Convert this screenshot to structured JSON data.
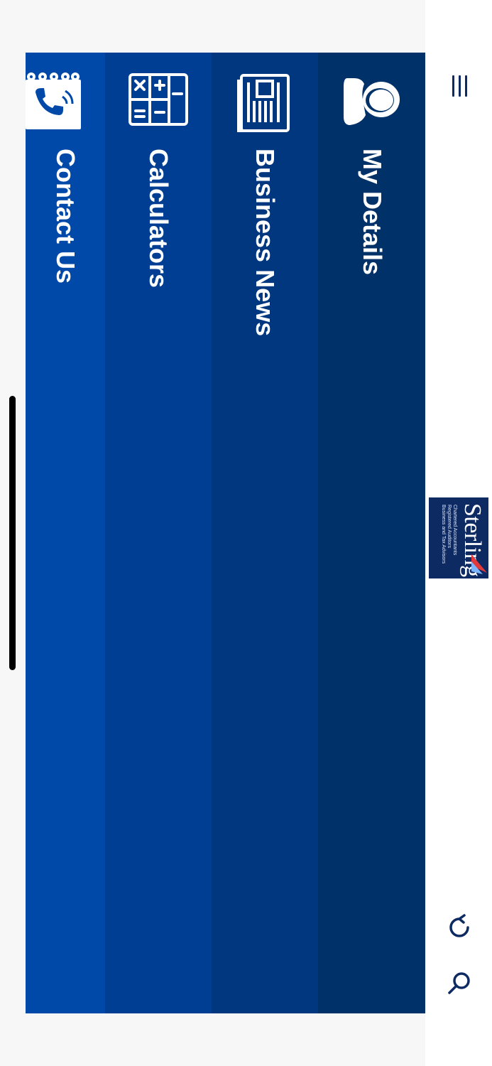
{
  "header": {
    "menu_icon": "hamburger-menu-icon",
    "logo": {
      "name": "Sterling",
      "lines": [
        "Chartered Accountants",
        "Registered Auditors",
        "Business and Tax Advisors"
      ]
    },
    "actions": [
      {
        "name": "refresh-icon"
      },
      {
        "name": "search-icon"
      }
    ]
  },
  "menu": {
    "items": [
      {
        "label": "My Details",
        "icon": "user-profile-icon",
        "color": "#003168"
      },
      {
        "label": "Business News",
        "icon": "newspaper-icon",
        "color": "#00377f"
      },
      {
        "label": "Calculators",
        "icon": "calculator-icon",
        "color": "#003e93"
      },
      {
        "label": "Contact Us",
        "icon": "phone-icon",
        "color": "#0049a9"
      }
    ]
  },
  "colors": {
    "brand_navy": "#0e2a63",
    "background": "#f7f7f7"
  }
}
